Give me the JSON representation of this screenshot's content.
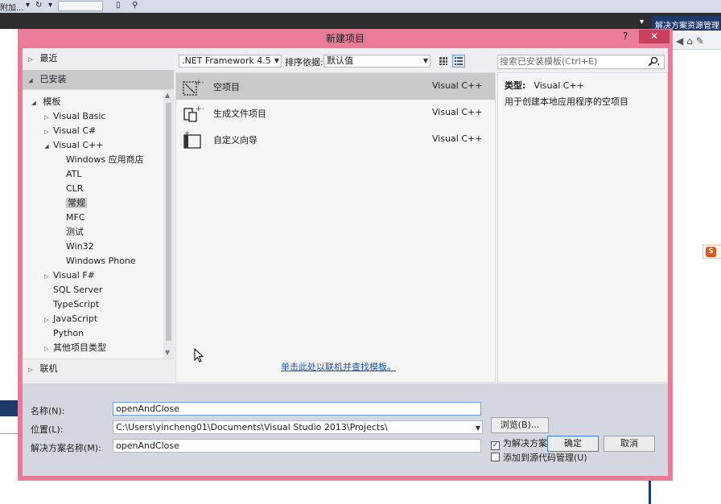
{
  "background": {
    "toolbar_text": "附加...",
    "solution_explorer_title": "解决方案资源管理"
  },
  "dialog": {
    "title": "新建项目",
    "help": "?",
    "close": "✕"
  },
  "tree": {
    "recent": "最近",
    "installed": "已安装",
    "templates": "模板",
    "items": [
      {
        "label": "Visual Basic",
        "level": 1,
        "arrow": "▷"
      },
      {
        "label": "Visual C#",
        "level": 1,
        "arrow": "▷"
      },
      {
        "label": "Visual C++",
        "level": 1,
        "arrow": "◢"
      },
      {
        "label": "Windows 应用商店",
        "level": 2,
        "arrow": ""
      },
      {
        "label": "ATL",
        "level": 2,
        "arrow": ""
      },
      {
        "label": "CLR",
        "level": 2,
        "arrow": ""
      },
      {
        "label": "常规",
        "level": 2,
        "arrow": "",
        "selected": true
      },
      {
        "label": "MFC",
        "level": 2,
        "arrow": ""
      },
      {
        "label": "测试",
        "level": 2,
        "arrow": ""
      },
      {
        "label": "Win32",
        "level": 2,
        "arrow": ""
      },
      {
        "label": "Windows Phone",
        "level": 2,
        "arrow": ""
      },
      {
        "label": "Visual F#",
        "level": 1,
        "arrow": "▷"
      },
      {
        "label": "SQL Server",
        "level": 1,
        "arrow": ""
      },
      {
        "label": "TypeScript",
        "level": 1,
        "arrow": ""
      },
      {
        "label": "JavaScript",
        "level": 1,
        "arrow": "▷"
      },
      {
        "label": "Python",
        "level": 1,
        "arrow": ""
      },
      {
        "label": "其他项目类型",
        "level": 1,
        "arrow": "▷"
      }
    ],
    "online": "联机"
  },
  "toolbar": {
    "framework": ".NET Framework 4.5",
    "sort_label": "排序依据:",
    "sort_value": "默认值",
    "search_placeholder": "搜索已安装模板(Ctrl+E)"
  },
  "templates": [
    {
      "name": "空项目",
      "lang": "Visual C++",
      "selected": true
    },
    {
      "name": "生成文件项目",
      "lang": "Visual C++",
      "selected": false
    },
    {
      "name": "自定义向导",
      "lang": "Visual C++",
      "selected": false
    }
  ],
  "online_link": "单击此处以联机并查找模板。",
  "details": {
    "type_label": "类型:",
    "type_value": "Visual C++",
    "description": "用于创建本地应用程序的空项目"
  },
  "form": {
    "name_label": "名称(N):",
    "name_value": "openAndClose",
    "location_label": "位置(L):",
    "location_value": "C:\\Users\\yincheng01\\Documents\\Visual Studio 2013\\Projects\\",
    "solution_label": "解决方案名称(M):",
    "solution_value": "openAndClose",
    "browse": "浏览(B)...",
    "create_dir": "为解决方案创建目录(D)",
    "create_dir_checked": true,
    "add_source": "添加到源代码管理(U)",
    "add_source_checked": false,
    "ok": "确定",
    "cancel": "取消"
  },
  "colors": {
    "dialog_border": "#e77b98",
    "link": "#1a56b8",
    "selection": "#c9c9cc"
  }
}
